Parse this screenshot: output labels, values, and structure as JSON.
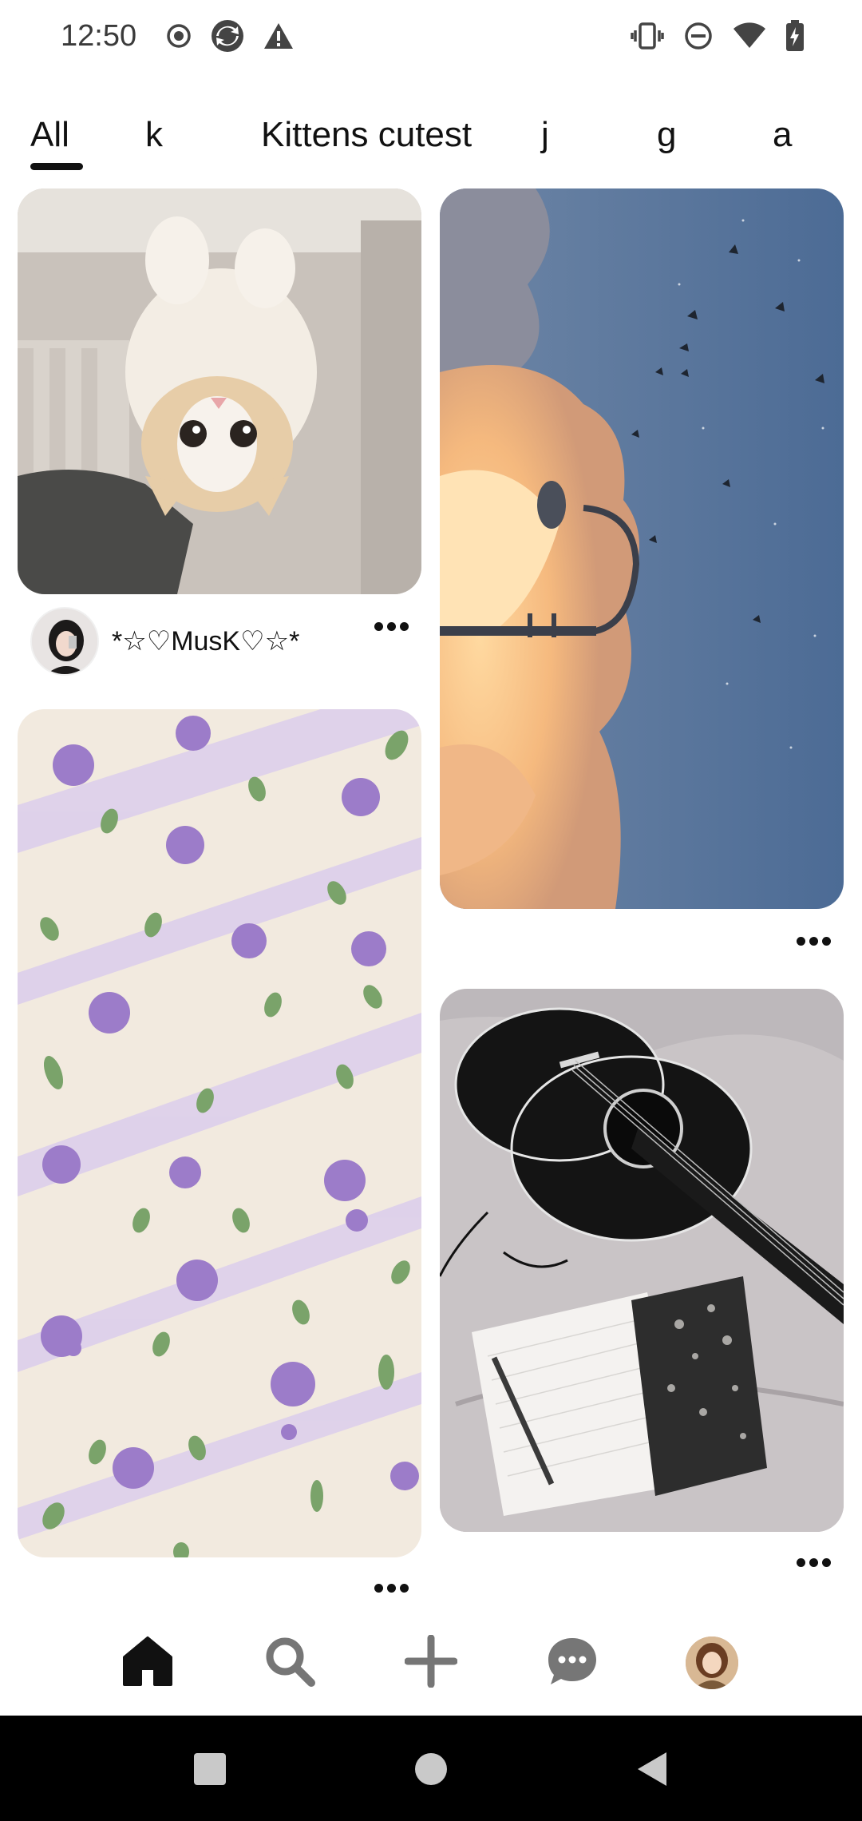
{
  "status_bar": {
    "time": "12:50",
    "left_icons": [
      "record-icon",
      "sync-icon",
      "warning-icon"
    ],
    "right_icons": [
      "vibrate-icon",
      "do-not-disturb-icon",
      "wifi-icon",
      "battery-charging-icon"
    ]
  },
  "tabs": [
    {
      "label": "All",
      "active": true
    },
    {
      "label": "k",
      "active": false
    },
    {
      "label": "Kittens cutest",
      "active": false
    },
    {
      "label": "j",
      "active": false
    },
    {
      "label": "g",
      "active": false
    },
    {
      "label": "a",
      "active": false
    }
  ],
  "pins": [
    {
      "id": "kitten",
      "subject": "kitten-photo",
      "author": "*☆♡MusK♡☆*",
      "has_more_menu": true
    },
    {
      "id": "sky",
      "subject": "sky-lamp-photo",
      "has_more_menu": true
    },
    {
      "id": "flowers",
      "subject": "purple-flowers-wallpaper",
      "has_more_menu": true
    },
    {
      "id": "guitar",
      "subject": "guitar-notebook-photo",
      "has_more_menu": true
    }
  ],
  "bottom_nav": [
    {
      "name": "home",
      "icon": "home-icon",
      "active": true
    },
    {
      "name": "search",
      "icon": "search-icon",
      "active": false
    },
    {
      "name": "create",
      "icon": "plus-icon",
      "active": false
    },
    {
      "name": "messages",
      "icon": "chat-bubble-icon",
      "active": false
    },
    {
      "name": "profile",
      "icon": "profile-avatar",
      "active": false
    }
  ],
  "system_nav": [
    "recents-icon",
    "home-circle-icon",
    "back-icon"
  ],
  "colors": {
    "background": "#ffffff",
    "text": "#111111",
    "status_text": "#3a3a3a",
    "nav_icon": "#767676",
    "system_bar": "#000000"
  }
}
